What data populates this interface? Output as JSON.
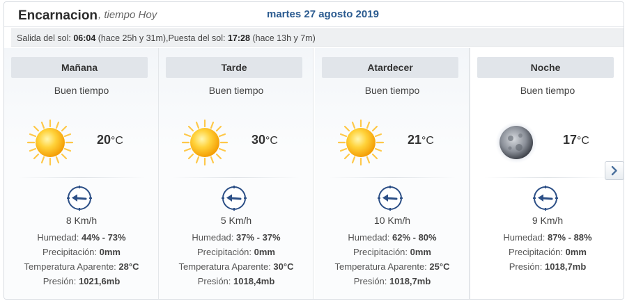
{
  "header": {
    "city": "Encarnacion",
    "subtitle": ", tiempo Hoy",
    "date": "martes 27 agosto 2019"
  },
  "sun": {
    "sunrise_label": "Salida del sol: ",
    "sunrise_time": "06:04",
    "sunrise_rel": " (hace 25h y 31m),",
    "sunset_label": "Puesta del sol: ",
    "sunset_time": "17:28",
    "sunset_rel": " (hace 13h y 7m)"
  },
  "labels": {
    "humidity": "Humedad: ",
    "precip": "Precipitación: ",
    "feels": "Temperatura Aparente: ",
    "pressure": "Presión: ",
    "unit_c": "°C"
  },
  "periods": [
    {
      "name": "Mañana",
      "condition": "Buen tiempo",
      "icon": "sun-icon",
      "temp": "20",
      "wind": "8 Km/h",
      "humidity": "44% - 73%",
      "precip": "0mm",
      "feels": "28°C",
      "pressure": "1021,6mb"
    },
    {
      "name": "Tarde",
      "condition": "Buen tiempo",
      "icon": "sun-icon",
      "temp": "30",
      "wind": "5 Km/h",
      "humidity": "37% - 37%",
      "precip": "0mm",
      "feels": "30°C",
      "pressure": "1018,4mb"
    },
    {
      "name": "Atardecer",
      "condition": "Buen tiempo",
      "icon": "sun-icon",
      "temp": "21",
      "wind": "10 Km/h",
      "humidity": "62% - 80%",
      "precip": "0mm",
      "feels": "25°C",
      "pressure": "1018,7mb"
    },
    {
      "name": "Noche",
      "condition": "Buen tiempo",
      "icon": "moon-icon",
      "temp": "17",
      "wind": "9 Km/h",
      "humidity": "87% - 88%",
      "precip": "0mm",
      "pressure": "1018,7mb"
    }
  ],
  "colors": {
    "date": "#2a5a8f",
    "header_bg": "#e1e5ea",
    "wind_arrow": "#2c4f86"
  }
}
